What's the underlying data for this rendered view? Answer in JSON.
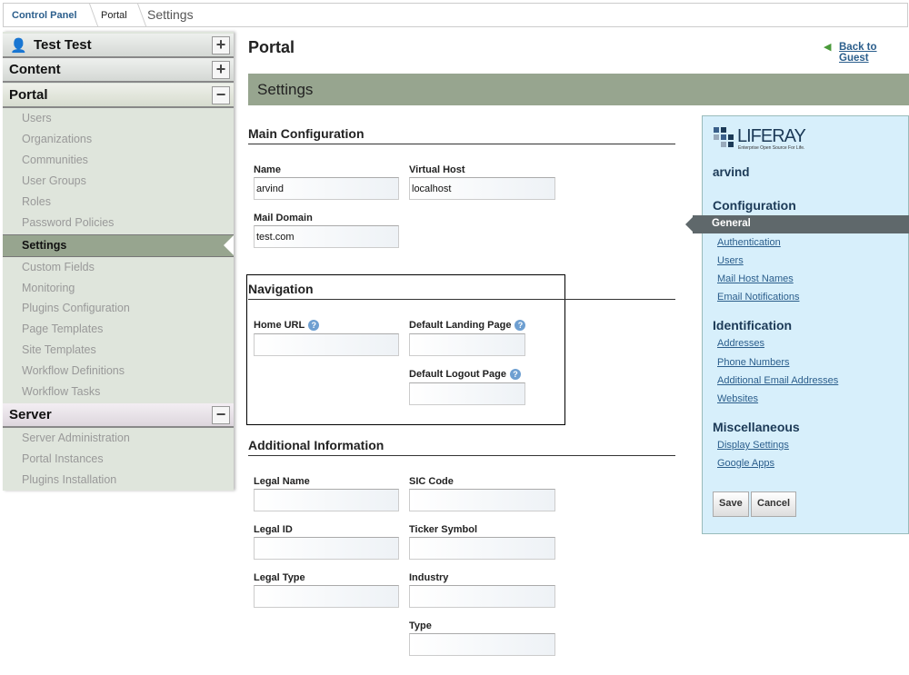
{
  "breadcrumb": {
    "items": [
      "Control Panel",
      "Portal",
      "Settings"
    ]
  },
  "sidebar": {
    "user": "Test Test",
    "content": "Content",
    "portal": "Portal",
    "server": "Server",
    "portal_items": [
      "Users",
      "Organizations",
      "Communities",
      "User Groups",
      "Roles",
      "Password Policies",
      "Settings",
      "Custom Fields",
      "Monitoring",
      "Plugins Configuration",
      "Page Templates",
      "Site Templates",
      "Workflow Definitions",
      "Workflow Tasks"
    ],
    "server_items": [
      "Server Administration",
      "Portal Instances",
      "Plugins Installation"
    ]
  },
  "header": {
    "title": "Portal",
    "back": "Back to Guest",
    "bar": "Settings"
  },
  "main": {
    "main_config": "Main Configuration",
    "name_label": "Name",
    "name_value": "arvind",
    "vhost_label": "Virtual Host",
    "vhost_value": "localhost",
    "mail_label": "Mail Domain",
    "mail_value": "test.com",
    "navigation": "Navigation",
    "home_url": "Home URL",
    "landing": "Default Landing Page",
    "logout": "Default Logout Page",
    "additional": "Additional Information",
    "legal_name": "Legal Name",
    "sic": "SIC Code",
    "legal_id": "Legal ID",
    "ticker": "Ticker Symbol",
    "legal_type": "Legal Type",
    "industry": "Industry",
    "type": "Type"
  },
  "panel": {
    "logo": "LIFERAY",
    "logo_tag": "Enterprise Open Source For Life.",
    "entity": "arvind",
    "configuration": "Configuration",
    "config_items": [
      "General",
      "Authentication",
      "Users",
      "Mail Host Names",
      "Email Notifications"
    ],
    "identification": "Identification",
    "id_items": [
      "Addresses",
      "Phone Numbers",
      "Additional Email Addresses",
      "Websites"
    ],
    "misc": "Miscellaneous",
    "misc_items": [
      "Display Settings",
      "Google Apps"
    ],
    "save": "Save",
    "cancel": "Cancel"
  }
}
